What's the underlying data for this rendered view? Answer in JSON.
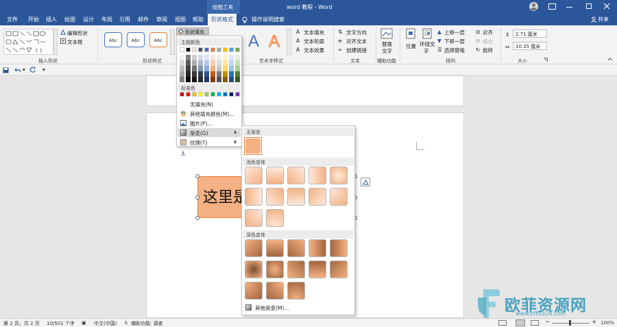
{
  "titlebar": {
    "drawing_tools_label": "绘图工具",
    "doc_title": "word 教程 - Word",
    "controls": [
      "minimize",
      "restore",
      "close"
    ]
  },
  "tabs": [
    "文件",
    "开始",
    "插入",
    "绘图",
    "设计",
    "布局",
    "引用",
    "邮件",
    "审阅",
    "视图",
    "帮助",
    "形状格式"
  ],
  "active_tab": "形状格式",
  "tell_me": "操作说明搜索",
  "share": "共享",
  "ribbon": {
    "insert_shapes": {
      "edit_shape": "编辑形状",
      "text_box": "文本框",
      "label": "插入形状"
    },
    "shape_styles": {
      "style_sample": "Abc",
      "fill_button": "形状填充",
      "label": "形状样式"
    },
    "wordart": {
      "letter": "A",
      "text_fill": "文本填充",
      "text_outline": "文本轮廓",
      "text_effects": "文本效果",
      "label": "艺术字样式"
    },
    "text": {
      "text_direction": "文字方向",
      "align_text": "对齐文本",
      "create_link": "创建链接",
      "label": "文本"
    },
    "accessibility": {
      "alt_text_line1": "替换",
      "alt_text_line2": "文字",
      "label": "辅助功能"
    },
    "arrange": {
      "position": "位置",
      "wrap_line1": "环绕文",
      "wrap_line2": "字",
      "bring_forward": "上移一层",
      "send_backward": "下移一层",
      "selection_pane": "选择窗格",
      "align": "对齐",
      "group": "组合",
      "rotate": "旋转",
      "label": "排列"
    },
    "size": {
      "height": "2.71 厘米",
      "width": "10.35 厘米",
      "label": "大小"
    }
  },
  "fill_menu": {
    "theme_colors_label": "主题颜色",
    "standard_colors_label": "标准色",
    "no_fill": "无填充(N)",
    "more_colors": "其他填充颜色(M)...",
    "picture": "图片(P)...",
    "gradient": "渐变(G)",
    "texture": "纹理(T)",
    "theme_top_row": [
      "#ffffff",
      "#000000",
      "#e7e6e6",
      "#44546a",
      "#4472c4",
      "#ed7d31",
      "#a5a5a5",
      "#ffc000",
      "#5b9bd5",
      "#70ad47"
    ],
    "theme_shade_columns": [
      [
        "#f2f2f2",
        "#d9d9d9",
        "#bfbfbf",
        "#a6a6a6",
        "#808080"
      ],
      [
        "#808080",
        "#595959",
        "#404040",
        "#262626",
        "#0d0d0d"
      ],
      [
        "#d0cece",
        "#aeabab",
        "#757171",
        "#3b3838",
        "#171616"
      ],
      [
        "#d6dce4",
        "#adb9ca",
        "#8496b0",
        "#333f4f",
        "#222a35"
      ],
      [
        "#d9e2f3",
        "#b4c6e7",
        "#8eaadb",
        "#2f5496",
        "#1f3864"
      ],
      [
        "#fbe5d5",
        "#f8cbad",
        "#f4b183",
        "#c55a11",
        "#833c0b"
      ],
      [
        "#ededed",
        "#dbdbdb",
        "#c9c9c9",
        "#7b7b7b",
        "#525252"
      ],
      [
        "#fff2cc",
        "#fee599",
        "#ffd965",
        "#bf8f00",
        "#7f6000"
      ],
      [
        "#deebf6",
        "#bdd7ee",
        "#9dc3e6",
        "#2e75b5",
        "#1f4e79"
      ],
      [
        "#e2efd9",
        "#c5e0b3",
        "#a8d08d",
        "#538135",
        "#375623"
      ]
    ],
    "standard_colors": [
      "#c00000",
      "#ff0000",
      "#ffc000",
      "#ffff00",
      "#92d050",
      "#00b050",
      "#00b0f0",
      "#0070c0",
      "#002060",
      "#7030a0"
    ]
  },
  "gradient_menu": {
    "no_gradient": "无渐变",
    "light_variations": "浅色变体",
    "dark_variations": "深色变体",
    "more_gradients": "其他渐变(M)..."
  },
  "document": {
    "shape_text": "这里是"
  },
  "statusbar": {
    "page": "第 2 页，共 2 页",
    "words": "10/501 个字",
    "language": "中文(中国)",
    "accessibility": "辅助功能: 调查",
    "zoom": "100%"
  },
  "watermark": {
    "text": "欧菲资源网",
    "url": "www.office26.com"
  },
  "colors": {
    "brand": "#2b579a",
    "shape_fill": "#f4b183"
  }
}
